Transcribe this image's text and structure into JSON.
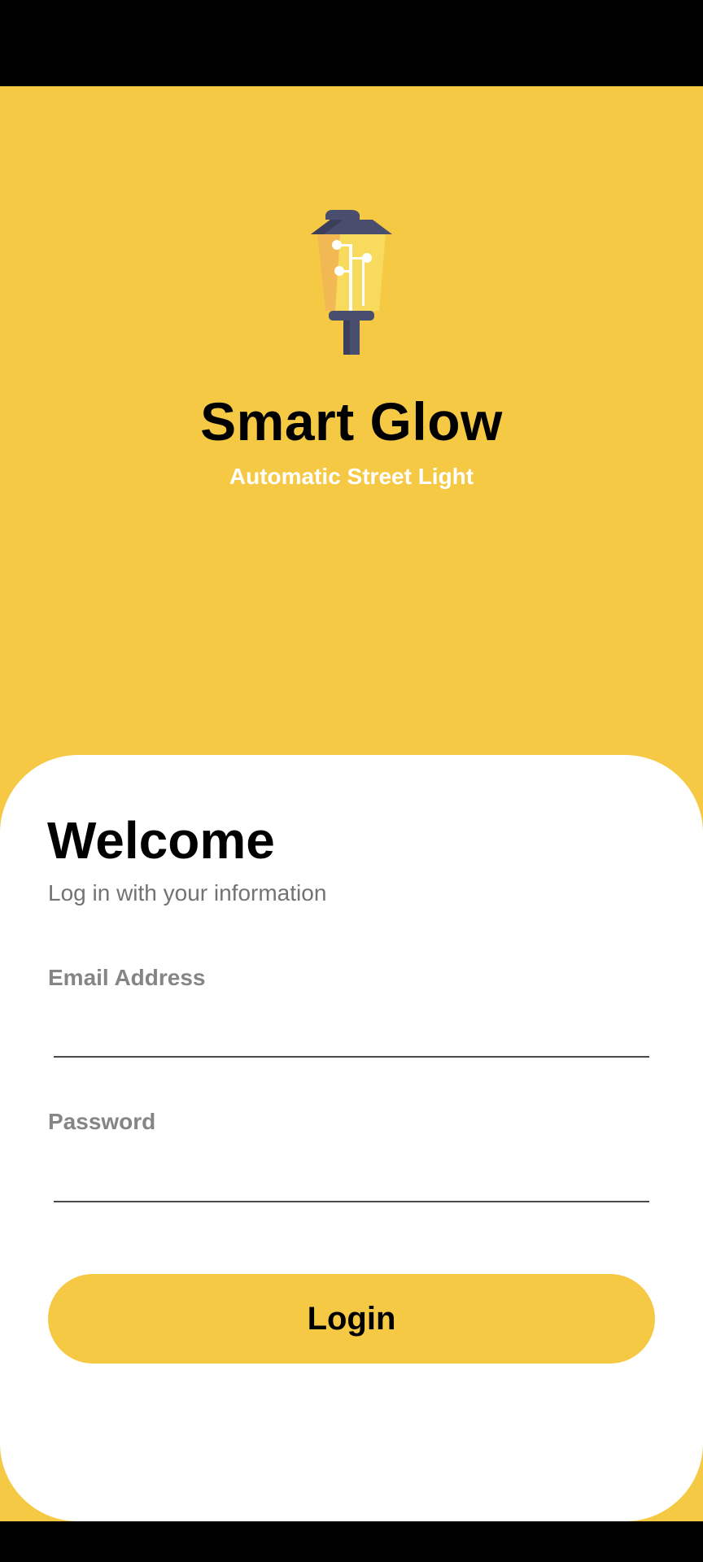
{
  "app": {
    "title": "Smart Glow",
    "subtitle": "Automatic Street Light",
    "logo_icon": "street-lamp-icon"
  },
  "login": {
    "heading": "Welcome",
    "subheading": "Log in with your information",
    "email_label": "Email Address",
    "email_value": "",
    "password_label": "Password",
    "password_value": "",
    "button_label": "Login"
  },
  "colors": {
    "accent": "#F6C945",
    "card": "#FFFFFF",
    "lamp_dark": "#4A4E6E",
    "lamp_glass": "#F8DB5C"
  }
}
